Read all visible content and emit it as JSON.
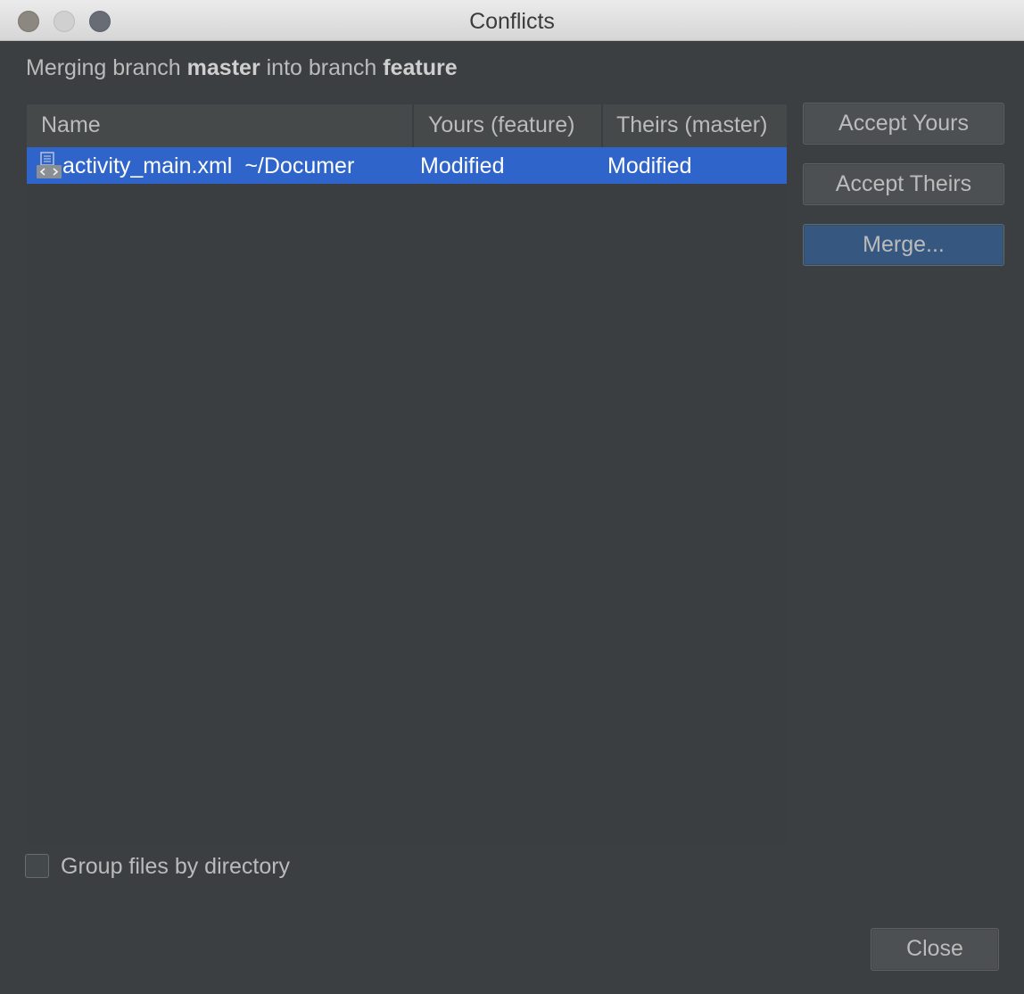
{
  "window": {
    "title": "Conflicts"
  },
  "subtitle": {
    "prefix": "Merging branch",
    "source_branch": "master",
    "middle": "into branch",
    "target_branch": "feature"
  },
  "table": {
    "columns": {
      "name": "Name",
      "yours": "Yours (feature)",
      "theirs": "Theirs (master)"
    },
    "rows": [
      {
        "file": "activity_main.xml",
        "path": "~/Documer",
        "yours": "Modified",
        "theirs": "Modified",
        "icon": "xml-file-icon",
        "selected": true
      }
    ]
  },
  "buttons": {
    "accept_yours": "Accept Yours",
    "accept_theirs": "Accept Theirs",
    "merge": "Merge...",
    "close": "Close"
  },
  "options": {
    "group_by_directory": {
      "label": "Group files by directory",
      "checked": false
    }
  },
  "colors": {
    "background": "#3c3f41",
    "selection": "#2f65ca",
    "default_button": "#365880"
  }
}
